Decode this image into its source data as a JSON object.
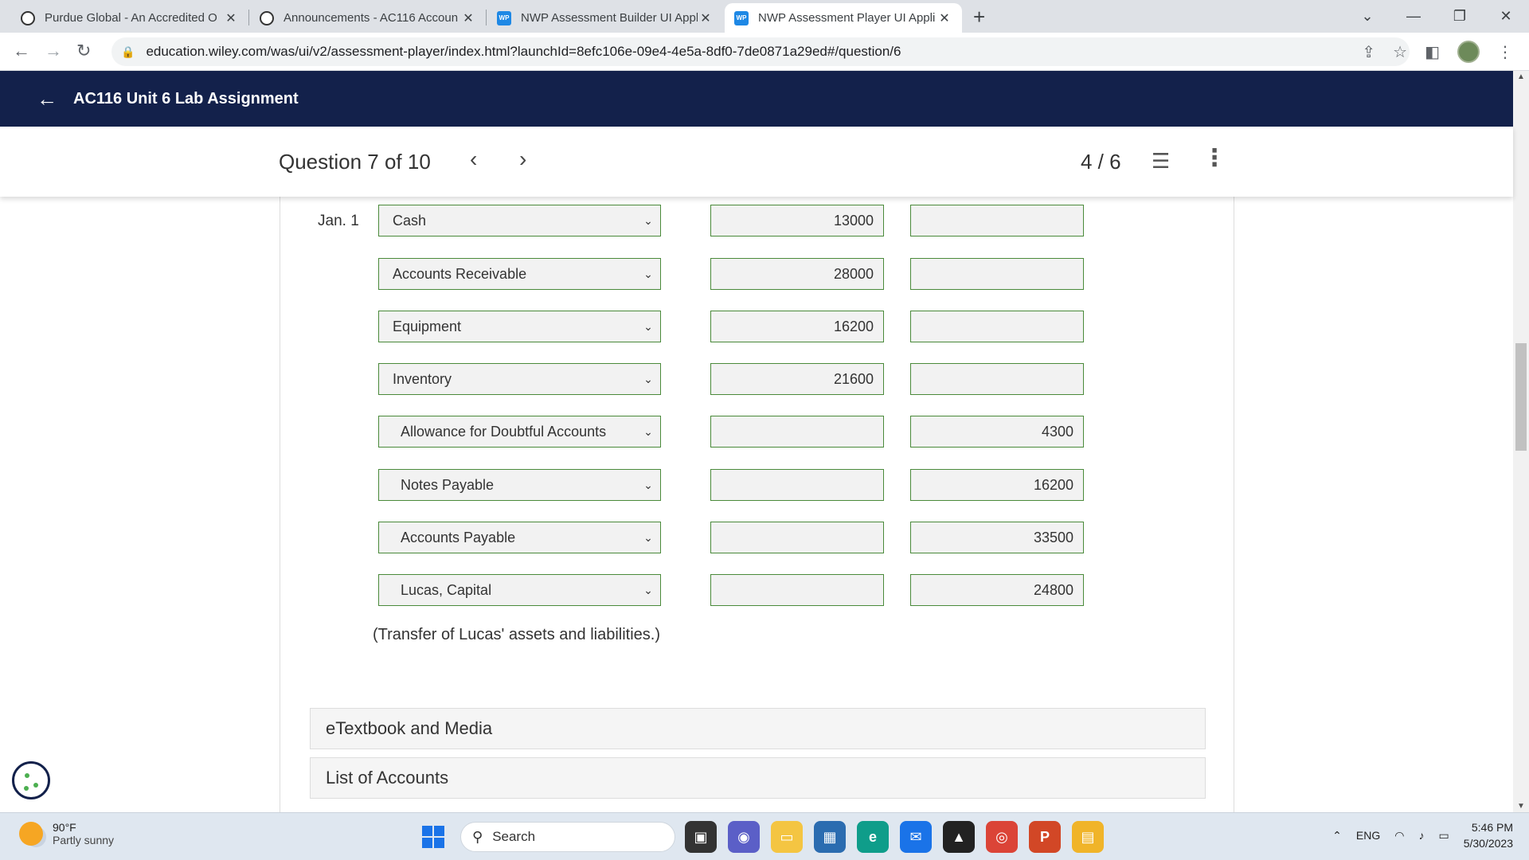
{
  "browser": {
    "tabs": [
      {
        "title": "Purdue Global - An Accredited O",
        "favicon": "purdue-icon",
        "active": false
      },
      {
        "title": "Announcements - AC116 Accoun",
        "favicon": "purdue-icon",
        "active": false
      },
      {
        "title": "NWP Assessment Builder UI Appl",
        "favicon": "wp-icon",
        "active": false
      },
      {
        "title": "NWP Assessment Player UI Appli",
        "favicon": "wp-icon",
        "active": true
      }
    ],
    "wp_favicon_text": "WP",
    "url": "education.wiley.com/was/ui/v2/assessment-player/index.html?launchId=8efc106e-09e4-4e5a-8df0-7de0871a29ed#/question/6"
  },
  "header": {
    "title": "AC116 Unit 6 Lab Assignment"
  },
  "question_bar": {
    "label": "Question 7 of 10",
    "progress": "4 / 6"
  },
  "journal": {
    "date": "Jan. 1",
    "entries": [
      {
        "account": "Cash",
        "debit": "13000",
        "credit": ""
      },
      {
        "account": "Accounts Receivable",
        "debit": "28000",
        "credit": ""
      },
      {
        "account": "Equipment",
        "debit": "16200",
        "credit": ""
      },
      {
        "account": "Inventory",
        "debit": "21600",
        "credit": ""
      },
      {
        "account": "Allowance for Doubtful Accounts",
        "debit": "",
        "credit": "4300"
      },
      {
        "account": "Notes Payable",
        "debit": "",
        "credit": "16200"
      },
      {
        "account": "Accounts Payable",
        "debit": "",
        "credit": "33500"
      },
      {
        "account": "Lucas, Capital",
        "debit": "",
        "credit": "24800"
      }
    ],
    "explanation": "(Transfer of Lucas' assets and liabilities.)"
  },
  "panels": {
    "etextbook": "eTextbook and Media",
    "accounts": "List of Accounts"
  },
  "taskbar": {
    "temperature": "90°F",
    "condition": "Partly sunny",
    "search_placeholder": "Search",
    "language": "ENG",
    "time": "5:46 PM",
    "date": "5/30/2023"
  },
  "colors": {
    "header_bg": "#13214b",
    "field_border": "#4a8a3a"
  }
}
